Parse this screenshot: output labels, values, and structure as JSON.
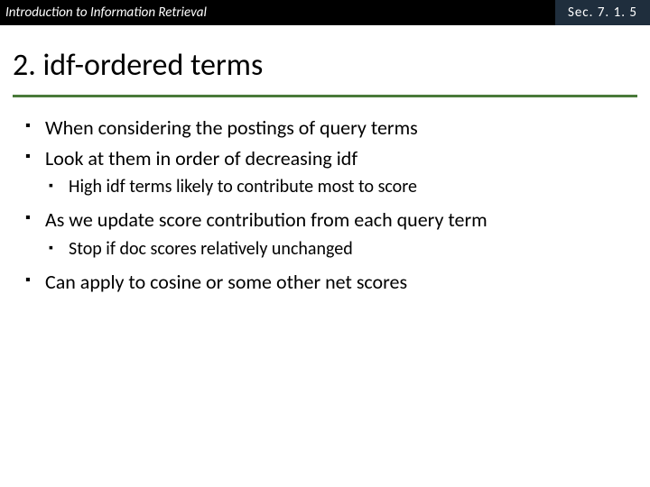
{
  "header": {
    "left": "Introduction to Information Retrieval",
    "right": "Sec. 7. 1. 5"
  },
  "title": "2. idf-ordered terms",
  "bullets": [
    {
      "text": "When considering the postings of query terms"
    },
    {
      "text": "Look at them in order of decreasing idf",
      "sub": [
        "High idf terms likely to contribute most to score"
      ]
    },
    {
      "text": "As we update score contribution from each query term",
      "sub": [
        "Stop if doc scores relatively unchanged"
      ]
    },
    {
      "text": "Can apply to cosine or some other net scores"
    }
  ]
}
